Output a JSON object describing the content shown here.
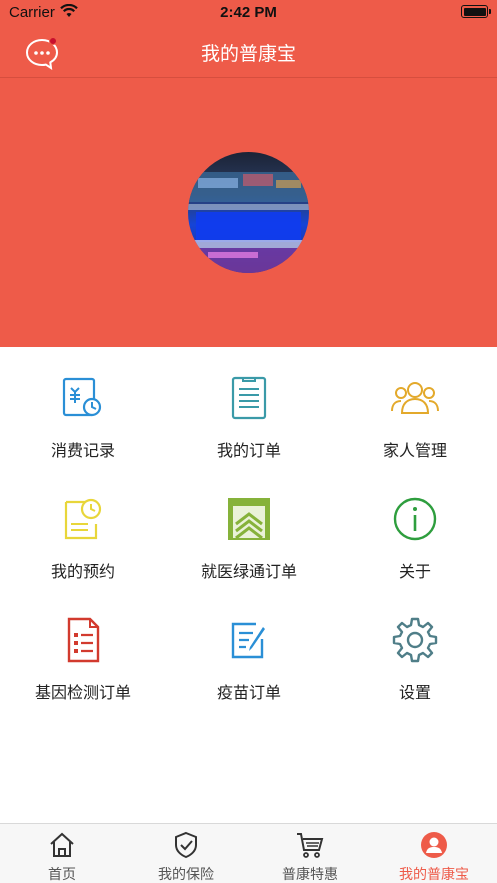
{
  "status_bar": {
    "carrier": "Carrier",
    "time": "2:42 PM"
  },
  "nav": {
    "title": "我的普康宝",
    "message_icon": "chat-bubble-icon",
    "has_unread": true
  },
  "colors": {
    "brand": "#EE5B49",
    "tab_active": "#EE5B49"
  },
  "menu": [
    {
      "label": "消费记录",
      "icon": "consumption-record-icon",
      "color": "#2A8FD6"
    },
    {
      "label": "我的订单",
      "icon": "order-list-icon",
      "color": "#3A9AA8"
    },
    {
      "label": "家人管理",
      "icon": "family-icon",
      "color": "#E3A92B"
    },
    {
      "label": "我的预约",
      "icon": "appointment-icon",
      "color": "#E8D63A"
    },
    {
      "label": "就医绿通订单",
      "icon": "green-channel-icon",
      "color": "#86B23A"
    },
    {
      "label": "关于",
      "icon": "info-icon",
      "color": "#2E9E3E"
    },
    {
      "label": "基因检测订单",
      "icon": "gene-test-icon",
      "color": "#D23A2E"
    },
    {
      "label": "疫苗订单",
      "icon": "vaccine-order-icon",
      "color": "#2A8FD6"
    },
    {
      "label": "设置",
      "icon": "settings-gear-icon",
      "color": "#4F7E88"
    }
  ],
  "tabs": [
    {
      "label": "首页",
      "icon": "home-icon",
      "active": false
    },
    {
      "label": "我的保险",
      "icon": "shield-check-icon",
      "active": false
    },
    {
      "label": "普康特惠",
      "icon": "cart-icon",
      "active": false
    },
    {
      "label": "我的普康宝",
      "icon": "profile-icon",
      "active": true
    }
  ]
}
